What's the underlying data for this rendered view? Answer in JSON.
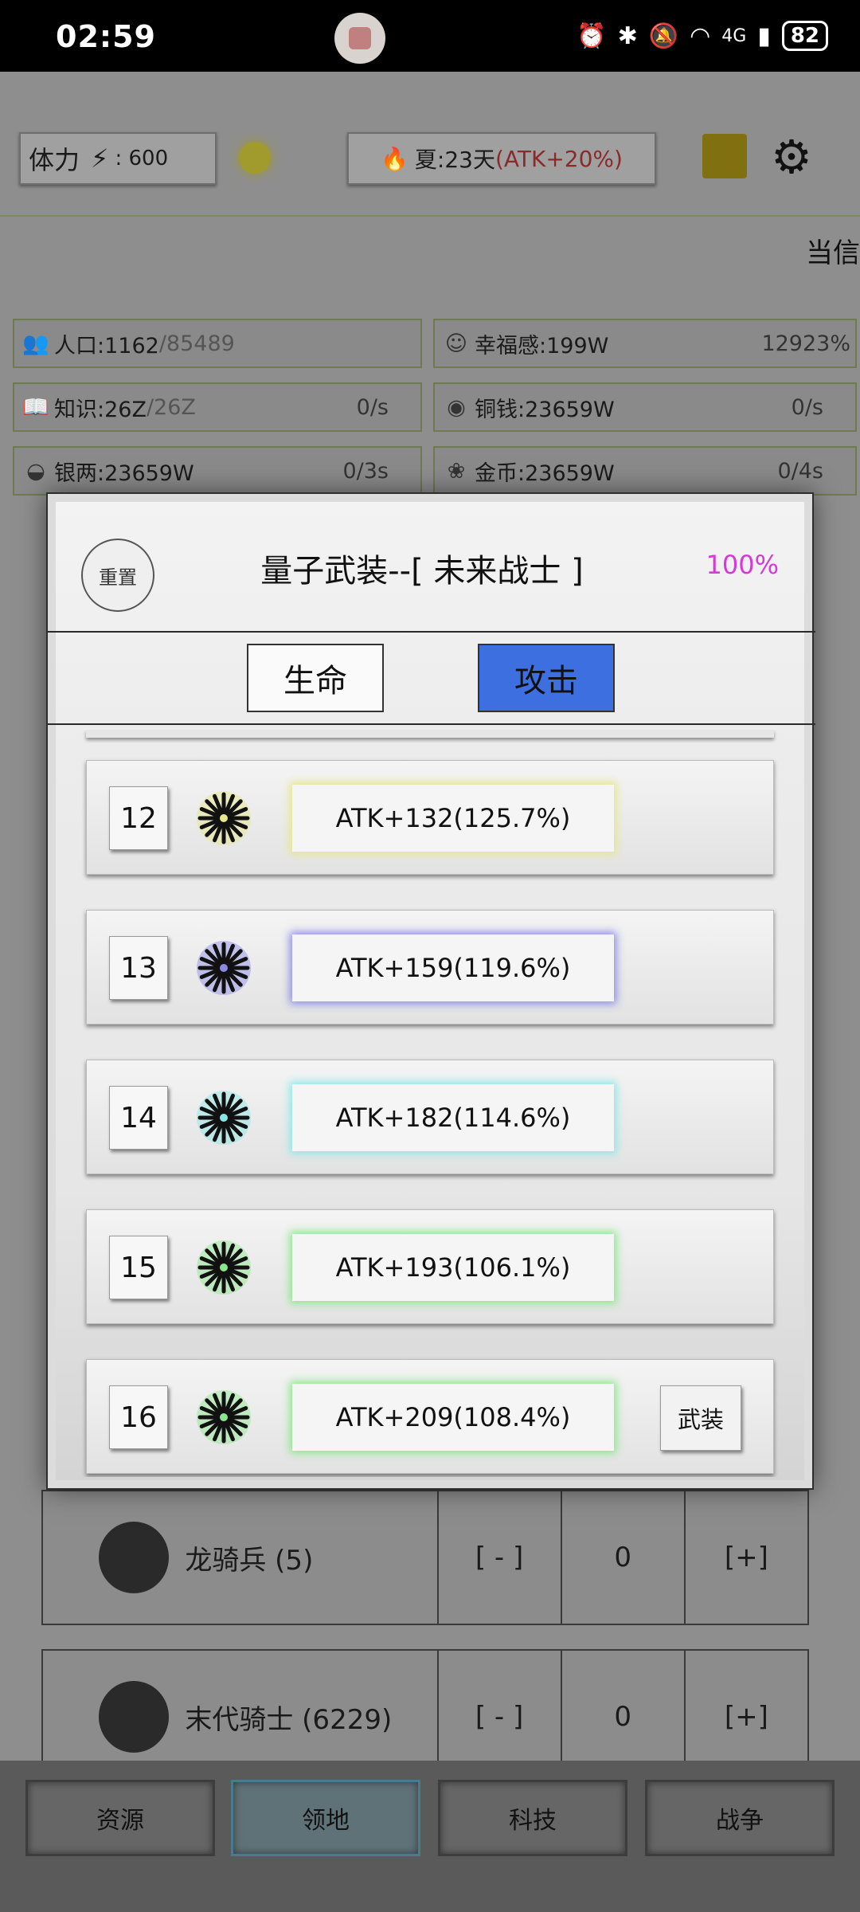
{
  "status_bar": {
    "time": "02:59",
    "battery": "82",
    "signal": "4G"
  },
  "header": {
    "stamina_label": "体力",
    "stamina_value": ": 600",
    "season_text": "夏:23天 ",
    "season_bonus": "(ATK+20%)",
    "truncated_text": "当信"
  },
  "resources": [
    {
      "icon": "people-icon",
      "label": "人口:1162",
      "suffix": "/85489",
      "rate": ""
    },
    {
      "icon": "smile-icon",
      "label": "幸福感:199W",
      "suffix": "",
      "rate": "12923%"
    },
    {
      "icon": "book-icon",
      "label": "知识:26Z",
      "suffix": "/26Z",
      "rate": "0/s"
    },
    {
      "icon": "coin-icon",
      "label": "铜钱:23659W",
      "suffix": "",
      "rate": "0/s"
    },
    {
      "icon": "ingot-icon",
      "label": "银两:23659W",
      "suffix": "",
      "rate": "0/3s"
    },
    {
      "icon": "gold-icon",
      "label": "金币:23659W",
      "suffix": "",
      "rate": "0/4s"
    }
  ],
  "units": [
    {
      "name": "龙骑兵 (5)",
      "minus": "[ - ]",
      "count": "0",
      "plus": "[+]"
    },
    {
      "name": "末代骑士 (6229)",
      "minus": "[ - ]",
      "count": "0",
      "plus": "[+]"
    }
  ],
  "nav": [
    "资源",
    "领地",
    "科技",
    "战争"
  ],
  "modal": {
    "reset_label": "重置",
    "title": "量子武装--[ 未来战士 ]",
    "percent": "100%",
    "tabs": {
      "life": "生命",
      "attack": "攻击"
    },
    "equip_label": "武装",
    "items": [
      {
        "level": "12",
        "stat": "ATK+132(125.7%)",
        "color": "#e6e68a",
        "equip": false
      },
      {
        "level": "13",
        "stat": "ATK+159(119.6%)",
        "color": "#8a8ae6",
        "equip": false
      },
      {
        "level": "14",
        "stat": "ATK+182(114.6%)",
        "color": "#8ae6e6",
        "equip": false
      },
      {
        "level": "15",
        "stat": "ATK+193(106.1%)",
        "color": "#8ae68a",
        "equip": false
      },
      {
        "level": "16",
        "stat": "ATK+209(108.4%)",
        "color": "#8ae68a",
        "equip": true
      }
    ]
  }
}
